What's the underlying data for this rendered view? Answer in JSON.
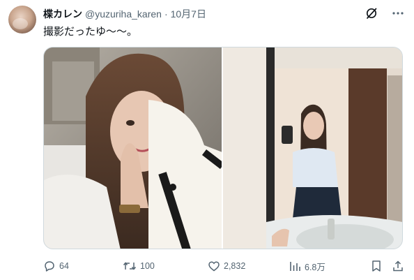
{
  "author": {
    "display_name": "楪カレン",
    "handle": "@yuzuriha_karen",
    "separator": "·",
    "date": "10月7日"
  },
  "header_icons": [
    "grok-icon",
    "more-icon"
  ],
  "tweet": {
    "text": "撮影だったゆ〜〜。"
  },
  "media": {
    "photos": [
      {
        "name": "selfie-photo",
        "alt": ""
      },
      {
        "name": "mirror-selfie-photo",
        "alt": ""
      }
    ]
  },
  "actions": {
    "reply_count": "64",
    "retweet_count": "100",
    "like_count": "2,832",
    "view_count": "6.8万"
  },
  "colors": {
    "text_primary": "#0f1419",
    "text_secondary": "#536471",
    "border": "#cfd9de"
  }
}
